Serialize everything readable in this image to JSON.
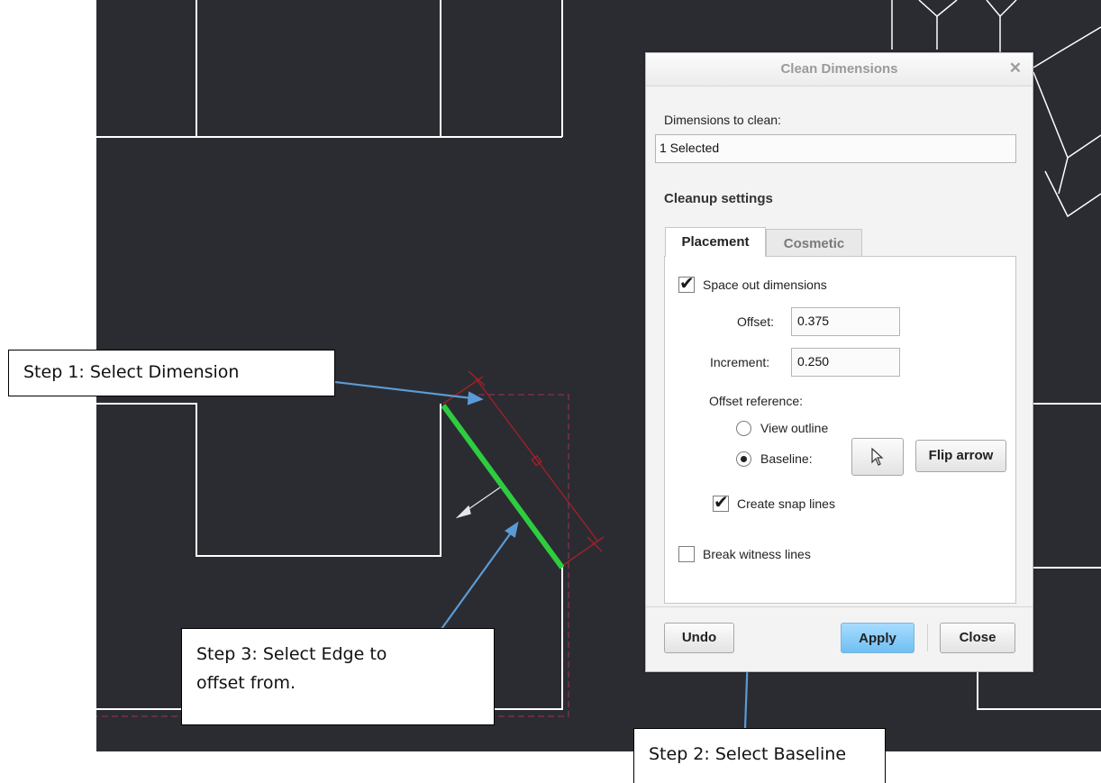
{
  "dialog": {
    "title": "Clean Dimensions",
    "close_glyph": "✕",
    "dims_label": "Dimensions to clean:",
    "dims_value": "1 Selected",
    "cleanup_heading": "Cleanup settings",
    "tabs": [
      {
        "label": "Placement",
        "active": true
      },
      {
        "label": "Cosmetic",
        "active": false
      }
    ],
    "space_out": {
      "label": "Space out dimensions",
      "checked": true
    },
    "offset": {
      "label": "Offset:",
      "value": "0.375"
    },
    "increment": {
      "label": "Increment:",
      "value": "0.250"
    },
    "offset_reference_label": "Offset reference:",
    "radio_view_outline": {
      "label": "View outline",
      "selected": false
    },
    "radio_baseline": {
      "label": "Baseline:",
      "selected": true
    },
    "select_icon": "cursor-arrow-icon",
    "flip_arrow_label": "Flip arrow",
    "snap_lines": {
      "label": "Create snap lines",
      "checked": true
    },
    "break_witness": {
      "label": "Break witness lines",
      "checked": false
    },
    "buttons": {
      "undo": "Undo",
      "apply": "Apply",
      "close": "Close"
    }
  },
  "callouts": {
    "step1": "Step 1: Select Dimension",
    "step2": "Step 2: Select Baseline",
    "step3_line1": "Step 3: Select Edge to",
    "step3_line2": "offset from."
  },
  "colors": {
    "canvas": "#2a2c31",
    "geometry": "#ffffff",
    "highlight_edge": "#2ecc40",
    "dimension": "#a0202a",
    "callout_arrow": "#5b9bd5",
    "apply_button": "#7ac5f5"
  }
}
